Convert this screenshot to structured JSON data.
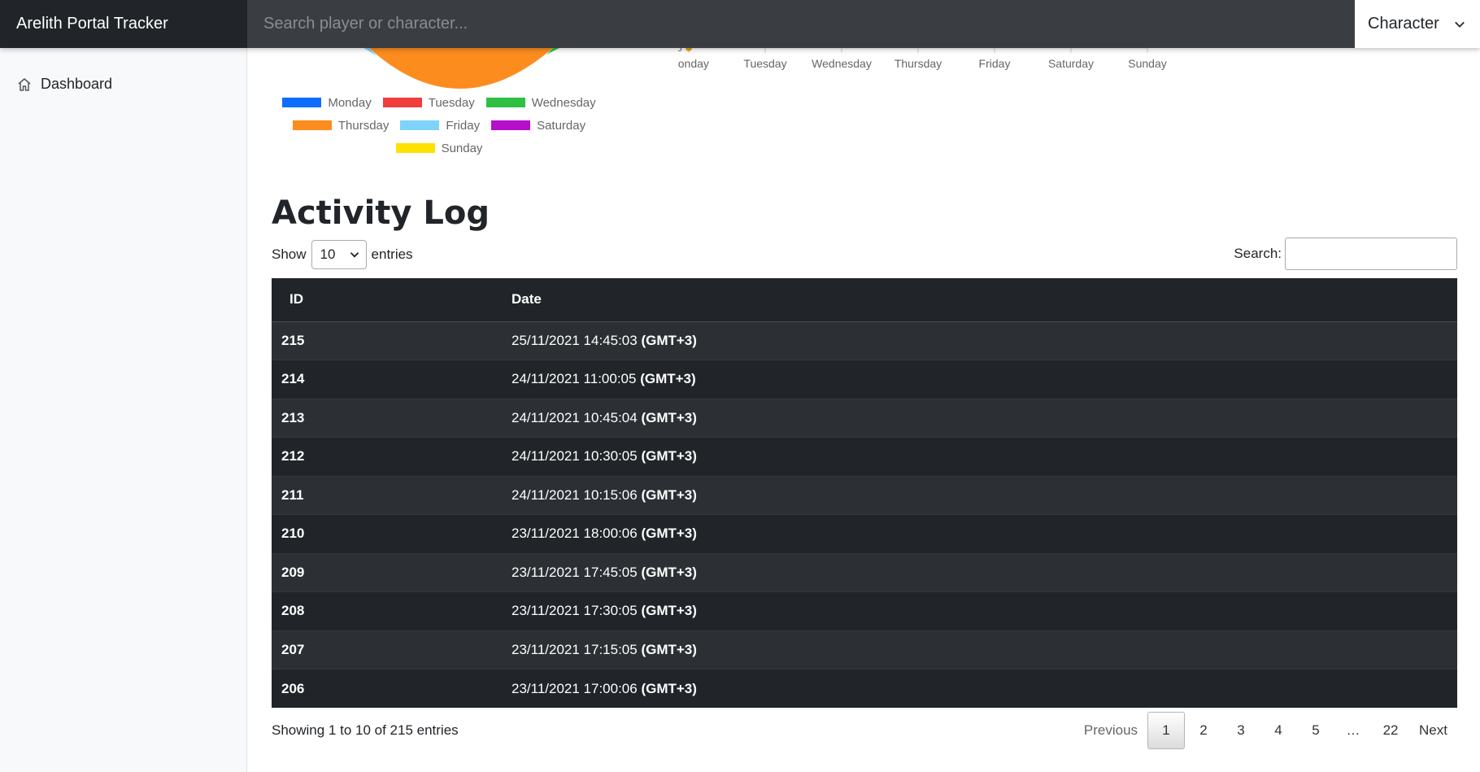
{
  "navbar": {
    "brand": "Arelith Portal Tracker",
    "search_placeholder": "Search player or character...",
    "type_select": "Character"
  },
  "sidebar": {
    "items": [
      {
        "label": "Dashboard",
        "icon": "home-icon"
      }
    ]
  },
  "pie_legend": [
    {
      "label": "Monday",
      "color": "#0d6efd"
    },
    {
      "label": "Tuesday",
      "color": "#f03e3e"
    },
    {
      "label": "Wednesday",
      "color": "#2fc043"
    },
    {
      "label": "Thursday",
      "color": "#fd8c1e"
    },
    {
      "label": "Friday",
      "color": "#7ed3fb"
    },
    {
      "label": "Saturday",
      "color": "#b70fcc"
    },
    {
      "label": "Sunday",
      "color": "#ffe100"
    }
  ],
  "line_axis": {
    "days": [
      "Monday",
      "Tuesday",
      "Wednesday",
      "Thursday",
      "Friday",
      "Saturday",
      "Sunday"
    ],
    "partial_tick": "3"
  },
  "activity_log": {
    "title": "Activity Log",
    "show_label": "Show",
    "entries_label": "entries",
    "page_length": "10",
    "search_label": "Search:",
    "columns": {
      "id": "ID",
      "date": "Date"
    },
    "rows": [
      {
        "id": "215",
        "date": "25/11/2021 14:45:03",
        "tz": "(GMT+3)"
      },
      {
        "id": "214",
        "date": "24/11/2021 11:00:05",
        "tz": "(GMT+3)"
      },
      {
        "id": "213",
        "date": "24/11/2021 10:45:04",
        "tz": "(GMT+3)"
      },
      {
        "id": "212",
        "date": "24/11/2021 10:30:05",
        "tz": "(GMT+3)"
      },
      {
        "id": "211",
        "date": "24/11/2021 10:15:06",
        "tz": "(GMT+3)"
      },
      {
        "id": "210",
        "date": "23/11/2021 18:00:06",
        "tz": "(GMT+3)"
      },
      {
        "id": "209",
        "date": "23/11/2021 17:45:05",
        "tz": "(GMT+3)"
      },
      {
        "id": "208",
        "date": "23/11/2021 17:30:05",
        "tz": "(GMT+3)"
      },
      {
        "id": "207",
        "date": "23/11/2021 17:15:05",
        "tz": "(GMT+3)"
      },
      {
        "id": "206",
        "date": "23/11/2021 17:00:06",
        "tz": "(GMT+3)"
      }
    ],
    "info": "Showing 1 to 10 of 215 entries",
    "pagination": {
      "previous": "Previous",
      "pages": [
        "1",
        "2",
        "3",
        "4",
        "5",
        "…",
        "22"
      ],
      "current": "1",
      "next": "Next"
    }
  }
}
